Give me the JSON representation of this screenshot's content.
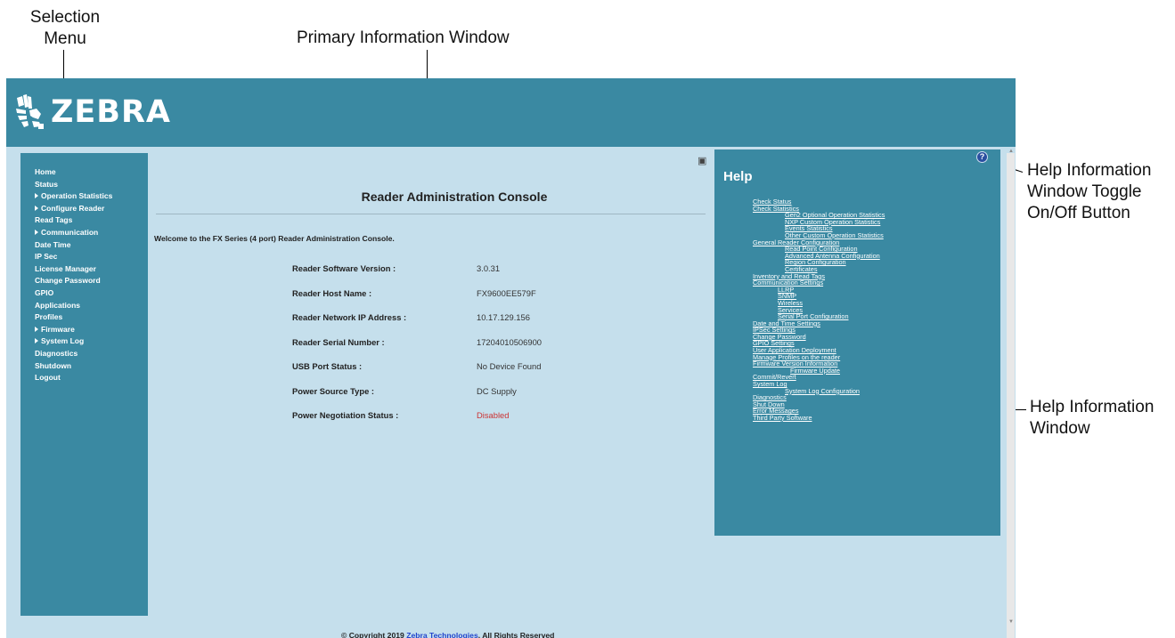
{
  "callouts": {
    "selection_menu": "Selection Menu",
    "primary_window": "Primary Information Window",
    "help_toggle": "Help Information Window Toggle On/Off Button",
    "help_window": "Help Information Window"
  },
  "header": {
    "logo_text": "ZEBRA"
  },
  "sidebar": {
    "items": [
      {
        "label": "Home",
        "expandable": false
      },
      {
        "label": "Status",
        "expandable": false
      },
      {
        "label": "Operation Statistics",
        "expandable": true
      },
      {
        "label": "Configure Reader",
        "expandable": true
      },
      {
        "label": "Read Tags",
        "expandable": false
      },
      {
        "label": "Communication",
        "expandable": true
      },
      {
        "label": "Date Time",
        "expandable": false
      },
      {
        "label": "IP Sec",
        "expandable": false
      },
      {
        "label": "License Manager",
        "expandable": false
      },
      {
        "label": "Change Password",
        "expandable": false
      },
      {
        "label": "GPIO",
        "expandable": false
      },
      {
        "label": "Applications",
        "expandable": false
      },
      {
        "label": "Profiles",
        "expandable": false
      },
      {
        "label": "Firmware",
        "expandable": true
      },
      {
        "label": "System Log",
        "expandable": true
      },
      {
        "label": "Diagnostics",
        "expandable": false
      },
      {
        "label": "Shutdown",
        "expandable": false
      },
      {
        "label": "Logout",
        "expandable": false
      }
    ]
  },
  "main": {
    "title": "Reader Administration Console",
    "welcome": "Welcome to the FX Series (4 port) Reader Administration Console.",
    "info": [
      {
        "label": "Reader Software Version :",
        "value": "3.0.31"
      },
      {
        "label": "Reader Host Name :",
        "value": "FX9600EE579F"
      },
      {
        "label": "Reader Network IP Address :",
        "value": "10.17.129.156"
      },
      {
        "label": "Reader Serial Number :",
        "value": "17204010506900"
      },
      {
        "label": "USB Port Status :",
        "value": "No Device Found"
      },
      {
        "label": "Power Source Type :",
        "value": "DC Supply"
      },
      {
        "label": "Power Negotiation Status :",
        "value": "Disabled"
      }
    ]
  },
  "footer": {
    "prefix": "© Copyright 2019 ",
    "link": "Zebra Technologies",
    "suffix": ". All Rights Reserved"
  },
  "help": {
    "title": "Help",
    "toggle_glyph": "?",
    "links": [
      {
        "label": "Check Status",
        "level": 1
      },
      {
        "label": "Check Statistics",
        "level": 1
      },
      {
        "label": "Gen2 Optional Operation Statistics",
        "level": 2
      },
      {
        "label": "NXP Custom Operation Statistics",
        "level": 2
      },
      {
        "label": "Events Statistics",
        "level": 2
      },
      {
        "label": "Other Custom Operation Statistics",
        "level": 2
      },
      {
        "label": "General Reader Configuration",
        "level": 1
      },
      {
        "label": "Read Point Configuration",
        "level": 2
      },
      {
        "label": "Advanced Antenna Configuration",
        "level": 2
      },
      {
        "label": "Region Configuration",
        "level": 2
      },
      {
        "label": "Certificates",
        "level": 2
      },
      {
        "label": "Inventory and Read Tags",
        "level": 1
      },
      {
        "label": "Communication Settings",
        "level": 1
      },
      {
        "label": "LLRP",
        "level": 2
      },
      {
        "label": "SNMP",
        "level": 2
      },
      {
        "label": "Wireless",
        "level": 2
      },
      {
        "label": "Services",
        "level": 2
      },
      {
        "label": "Serial Port Configuration",
        "level": 2
      },
      {
        "label": "Date and Time Settings",
        "level": 1
      },
      {
        "label": "IPSec Settings",
        "level": 1
      },
      {
        "label": "Change Password",
        "level": 1
      },
      {
        "label": "GPIO Settings",
        "level": 1
      },
      {
        "label": "User Application Deployment",
        "level": 1
      },
      {
        "label": "Manage Profiles on the reader",
        "level": 1
      },
      {
        "label": "Firmware Version Information",
        "level": 1
      },
      {
        "label": "Firmware Update",
        "level": 3
      },
      {
        "label": "Commit/Revert",
        "level": 1
      },
      {
        "label": "System Log",
        "level": 1
      },
      {
        "label": "System Log Configuration",
        "level": 2
      },
      {
        "label": "Diagnostics",
        "level": 1
      },
      {
        "label": "Shut Down",
        "level": 1
      },
      {
        "label": "Error Messages",
        "level": 1
      },
      {
        "label": "Third Party Software",
        "level": 1
      }
    ]
  },
  "colors": {
    "header_bg": "#3a89a2",
    "page_bg": "#c5dfec",
    "disabled_text": "#cc3333",
    "link": "#2244cc"
  }
}
